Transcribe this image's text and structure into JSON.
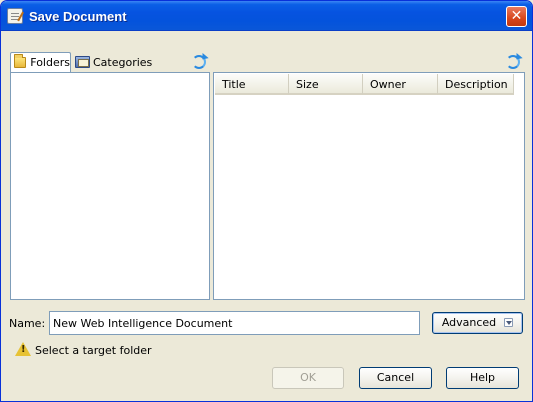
{
  "window": {
    "title": "Save Document",
    "close_glyph": "✕"
  },
  "tabs": [
    {
      "label": "Folders",
      "icon": "folder-icon",
      "selected": true
    },
    {
      "label": "Categories",
      "icon": "categories-icon",
      "selected": false
    }
  ],
  "list": {
    "columns": [
      "Title",
      "Size",
      "Owner",
      "Description"
    ],
    "rows": []
  },
  "name_field": {
    "label": "Name:",
    "value": "New Web Intelligence Document"
  },
  "buttons": {
    "advanced": "Advanced",
    "ok": "OK",
    "cancel": "Cancel",
    "help": "Help"
  },
  "status": {
    "warning_glyph": "!",
    "message": "Select a target folder"
  },
  "colors": {
    "titlebar": "#0653e0",
    "dialog_bg": "#ece9d8",
    "border": "#7f9db9"
  }
}
